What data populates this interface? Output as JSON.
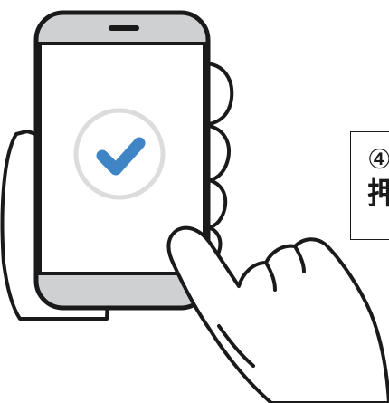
{
  "step": {
    "number": "④",
    "text": "押"
  },
  "colors": {
    "outline": "#1a1a1a",
    "phone_bezel": "#cfd0d1",
    "screen": "#ffffff",
    "check_ring": "#dcdcdc",
    "check_mark": "#3f84c4"
  },
  "icons": {
    "status": "check-icon"
  }
}
